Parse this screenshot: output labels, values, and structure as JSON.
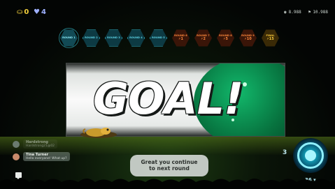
{
  "hud": {
    "coins": "0",
    "hearts": "4",
    "views": "8.988",
    "score": "10.988"
  },
  "rounds": [
    {
      "label": "ROUND 1",
      "value": "",
      "state": "current"
    },
    {
      "label": "ROUND 2",
      "value": "",
      "state": "done"
    },
    {
      "label": "ROUND 3",
      "value": "",
      "state": "done"
    },
    {
      "label": "ROUND 4",
      "value": "",
      "state": "done"
    },
    {
      "label": "ROUND 5",
      "value": "",
      "state": "done"
    },
    {
      "label": "ROUND 6",
      "value": "⚡1",
      "state": "locked"
    },
    {
      "label": "ROUND 7",
      "value": "⚡2",
      "state": "locked"
    },
    {
      "label": "ROUND 8",
      "value": "⚡5",
      "state": "locked"
    },
    {
      "label": "ROUND 9",
      "value": "⚡10",
      "state": "locked"
    },
    {
      "label": "FINAL",
      "value": "⚡15",
      "state": "final"
    }
  ],
  "banner": {
    "title": "GOAL!"
  },
  "chat": {
    "messages": [
      {
        "user": "Hardstrong",
        "text": "Hardstrong21@02",
        "style": "faded",
        "color": "#6b7a6f"
      },
      {
        "user": "Tina Turner",
        "text": "Hello everyone! What up?",
        "style": "active",
        "color": "#c98b6b"
      }
    ]
  },
  "toast": {
    "line1": "Great you continue",
    "line2": "to next round"
  },
  "timer": {
    "count": "3",
    "label": "36 ▾"
  },
  "colors": {
    "accent": "#2fb7cf",
    "locked": "#ff8a3d",
    "final": "#ffcf3d",
    "goal_green": "#07733f"
  }
}
